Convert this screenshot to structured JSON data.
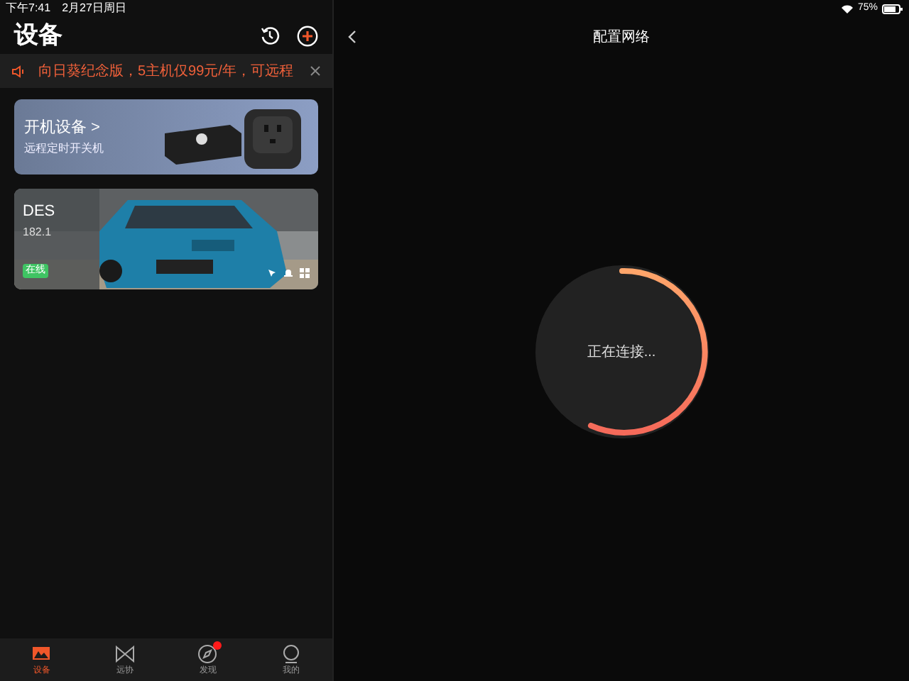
{
  "status_bar": {
    "time": "下午7:41",
    "date": "2月27日周日",
    "battery": "75%"
  },
  "left_panel": {
    "title": "设备",
    "banner": {
      "text": "向日葵纪念版，5主机仅99元/年，可远程"
    },
    "power_card": {
      "title": "开机设备 >",
      "subtitle": "远程定时开关机"
    },
    "device_card": {
      "name": "DES",
      "ip": "182.1",
      "status": "在线"
    },
    "tabs": [
      {
        "label": "设备",
        "selected": true,
        "badge": false
      },
      {
        "label": "远协",
        "selected": false,
        "badge": false
      },
      {
        "label": "发现",
        "selected": false,
        "badge": true
      },
      {
        "label": "我的",
        "selected": false,
        "badge": false
      }
    ]
  },
  "right_panel": {
    "title": "配置网络",
    "progress_text": "正在连接..."
  }
}
